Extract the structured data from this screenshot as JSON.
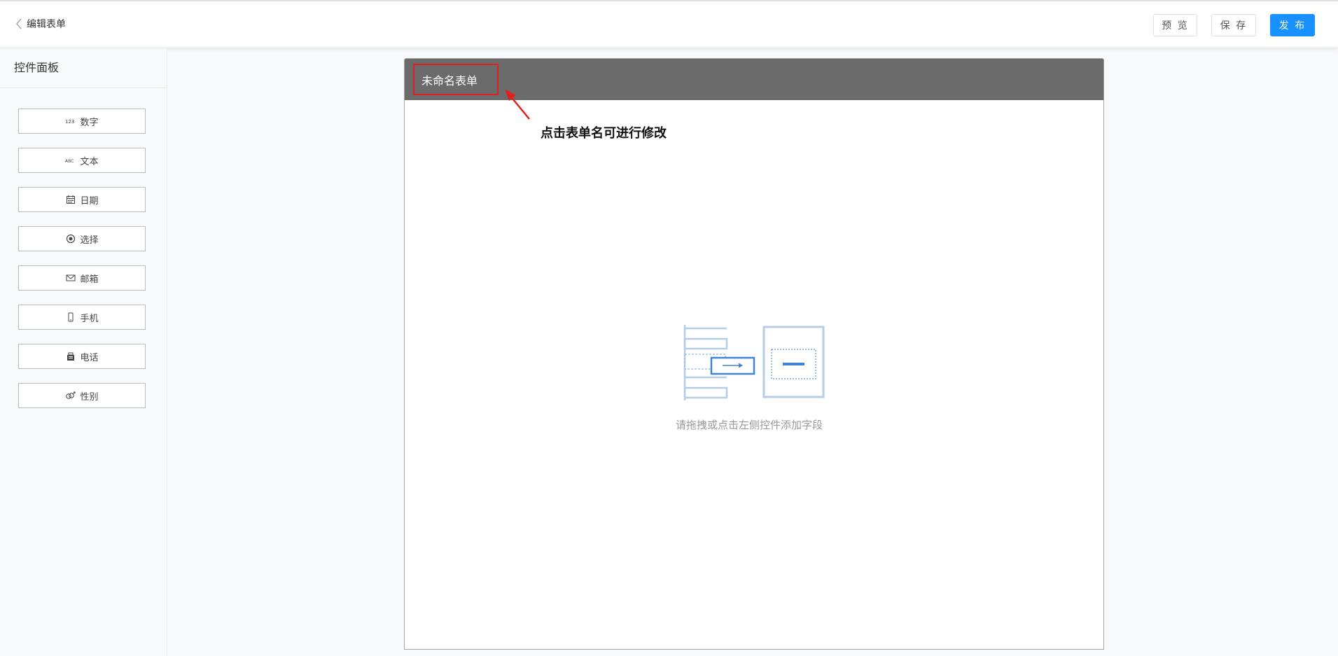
{
  "header": {
    "back_title": "编辑表单",
    "preview_label": "预 览",
    "save_label": "保 存",
    "publish_label": "发 布"
  },
  "sidebar": {
    "title": "控件面板",
    "controls": [
      {
        "label": "数字",
        "icon": "number-icon"
      },
      {
        "label": "文本",
        "icon": "text-icon"
      },
      {
        "label": "日期",
        "icon": "calendar-icon"
      },
      {
        "label": "选择",
        "icon": "radio-icon"
      },
      {
        "label": "邮箱",
        "icon": "mail-icon"
      },
      {
        "label": "手机",
        "icon": "mobile-icon"
      },
      {
        "label": "电话",
        "icon": "telephone-icon"
      },
      {
        "label": "性别",
        "icon": "gender-icon"
      }
    ]
  },
  "form": {
    "name": "未命名表单",
    "empty_hint": "请拖拽或点击左侧控件添加字段"
  },
  "annotation": {
    "text": "点击表单名可进行修改"
  },
  "colors": {
    "primary": "#1890ff",
    "form_header": "#6b6b6b",
    "highlight": "#e02020"
  }
}
